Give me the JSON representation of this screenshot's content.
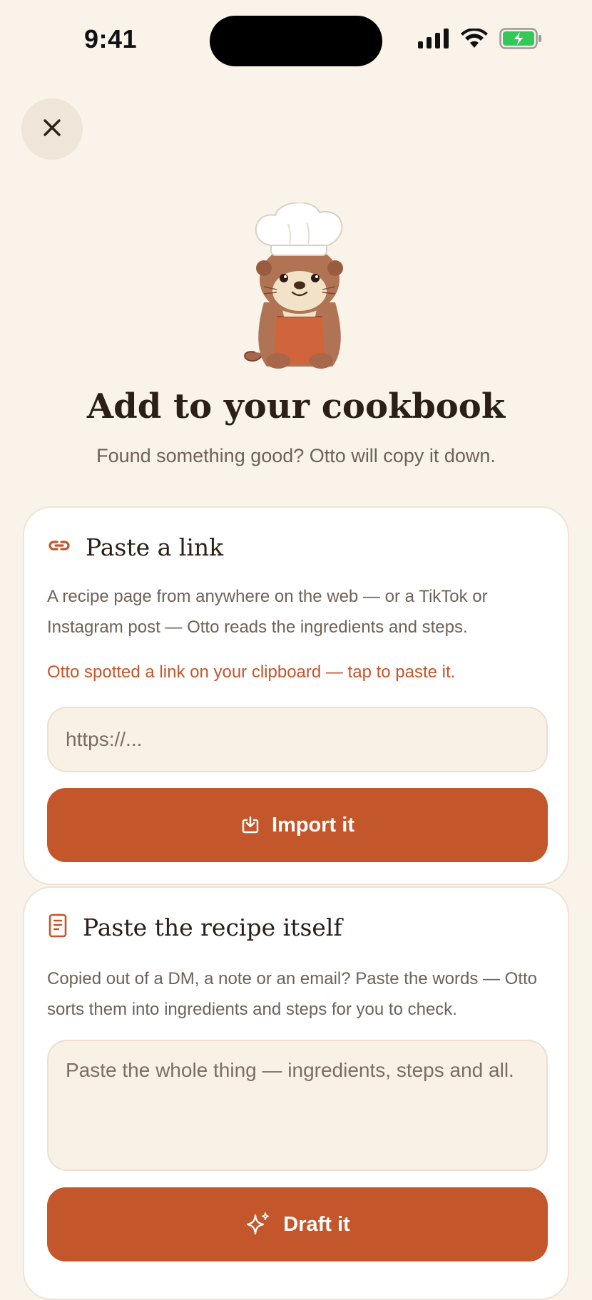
{
  "status_bar": {
    "time": "9:41",
    "icons": [
      "cellular-signal-icon",
      "wifi-icon",
      "battery-charging-icon"
    ]
  },
  "header": {
    "close_icon": "close-icon"
  },
  "hero": {
    "title": "Add to your cookbook",
    "subtitle": "Found something good? Otto will copy it down."
  },
  "link_card": {
    "icon": "link-icon",
    "title": "Paste a link",
    "description": "A recipe page from anywhere on the web — or a TikTok or Instagram post — Otto reads the ingredients and steps.",
    "clipboard_hint": "Otto spotted a link on your clipboard — tap to paste it.",
    "input_value": "",
    "input_placeholder": "https://...",
    "button_icon": "download-icon",
    "button_label": "Import it"
  },
  "text_card": {
    "icon": "document-icon",
    "title": "Paste the recipe itself",
    "description": "Copied out of a DM, a note or an email? Paste the words — Otto sorts them into ingredients and steps for you to check.",
    "textarea_value": "",
    "textarea_placeholder": "Paste the whole thing — ingredients, steps and all.",
    "button_icon": "sparkles-icon",
    "button_label": "Draft it"
  },
  "colors": {
    "background": "#faf3ea",
    "accent": "#c4562c",
    "card": "#ffffff",
    "input_bg": "#faf1e6",
    "title_text": "#2b2018",
    "body_text": "#6e6258"
  }
}
